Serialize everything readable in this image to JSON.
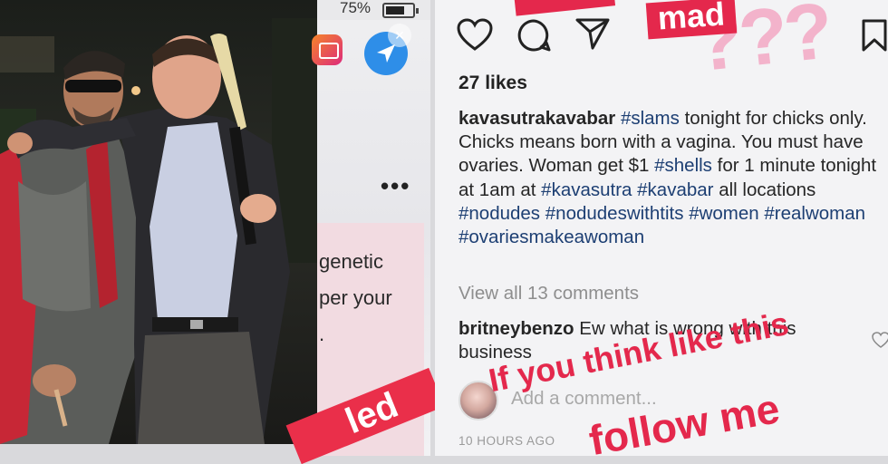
{
  "statusbar": {
    "battery_percent": "75%",
    "battery_level": 0.75
  },
  "behind_screen": {
    "more_label": "•••",
    "fragments": [
      "genetic",
      "per your",
      "."
    ],
    "sticker_text": "led"
  },
  "post": {
    "likes": "27 likes",
    "caption": {
      "username": "kavasutrakavabar",
      "segments": [
        {
          "type": "tag",
          "text": "#slams"
        },
        {
          "type": "text",
          "text": " tonight for chicks only. Chicks means born with a vagina. You must have ovaries. Woman get $1 "
        },
        {
          "type": "tag",
          "text": "#shells"
        },
        {
          "type": "text",
          "text": " for 1 minute tonight at 1am at "
        },
        {
          "type": "tag",
          "text": "#kavasutra"
        },
        {
          "type": "text",
          "text": " "
        },
        {
          "type": "tag",
          "text": "#kavabar"
        },
        {
          "type": "text",
          "text": " all locations "
        },
        {
          "type": "tag",
          "text": "#nodudes"
        },
        {
          "type": "text",
          "text": " "
        },
        {
          "type": "tag",
          "text": "#nodudeswithtits"
        },
        {
          "type": "text",
          "text": " "
        },
        {
          "type": "tag",
          "text": "#women"
        },
        {
          "type": "text",
          "text": " "
        },
        {
          "type": "tag",
          "text": "#realwoman"
        },
        {
          "type": "text",
          "text": " "
        },
        {
          "type": "tag",
          "text": "#ovariesmakeawoman"
        }
      ]
    },
    "view_comments": "View all 13 comments",
    "comment": {
      "username": "britneybenzo",
      "text": "Ew what is wrong with this business"
    },
    "add_comment_placeholder": "Add a comment...",
    "timestamp": "10 HOURS AGO"
  },
  "overlays": {
    "mad": "mad",
    "question_marks": "???",
    "line1": "If you think like this",
    "line2": "follow me"
  },
  "colors": {
    "accent_red": "#e4284c",
    "hashtag": "#1d3f73",
    "pink": "#f4a8c4"
  }
}
